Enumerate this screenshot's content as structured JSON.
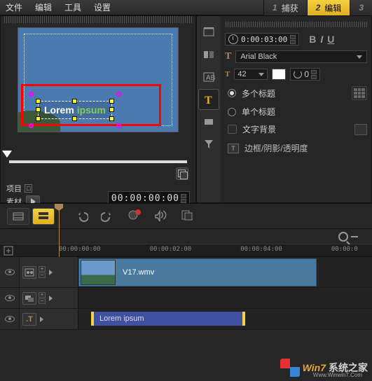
{
  "menu": {
    "file": "文件",
    "edit": "编辑",
    "tools": "工具",
    "settings": "设置"
  },
  "steps": {
    "s1num": "1",
    "s1": "捕获",
    "s2num": "2",
    "s2": "编辑",
    "s3num": "3"
  },
  "preview": {
    "title_word1": "Lorem ",
    "title_word2": "ipsum",
    "project_label": "项目",
    "material_label": "素材",
    "timecode": "00:00:00:00"
  },
  "props": {
    "duration": "0:00:03:00",
    "font": "Arial Black",
    "size": "42",
    "rotation": "0",
    "radio_multi": "多个标题",
    "radio_single": "单个标题",
    "check_bg": "文字背景",
    "link_border": "边框/阴影/透明度",
    "bold": "B",
    "italic": "I",
    "underline": "U",
    "ticon": "T",
    "sizelabel": "T",
    "rotnum": "0"
  },
  "timeline": {
    "ruler": [
      "00:00:00:00",
      "00:00:02:00",
      "00:00:04:00",
      "00:00:0"
    ],
    "video_clip": "V17.wmv",
    "title_clip": "Lorem ipsum"
  },
  "watermark": {
    "brand1": "Win7",
    "brand2": "系统之家",
    "url": "Www.Winwin7.Com"
  }
}
